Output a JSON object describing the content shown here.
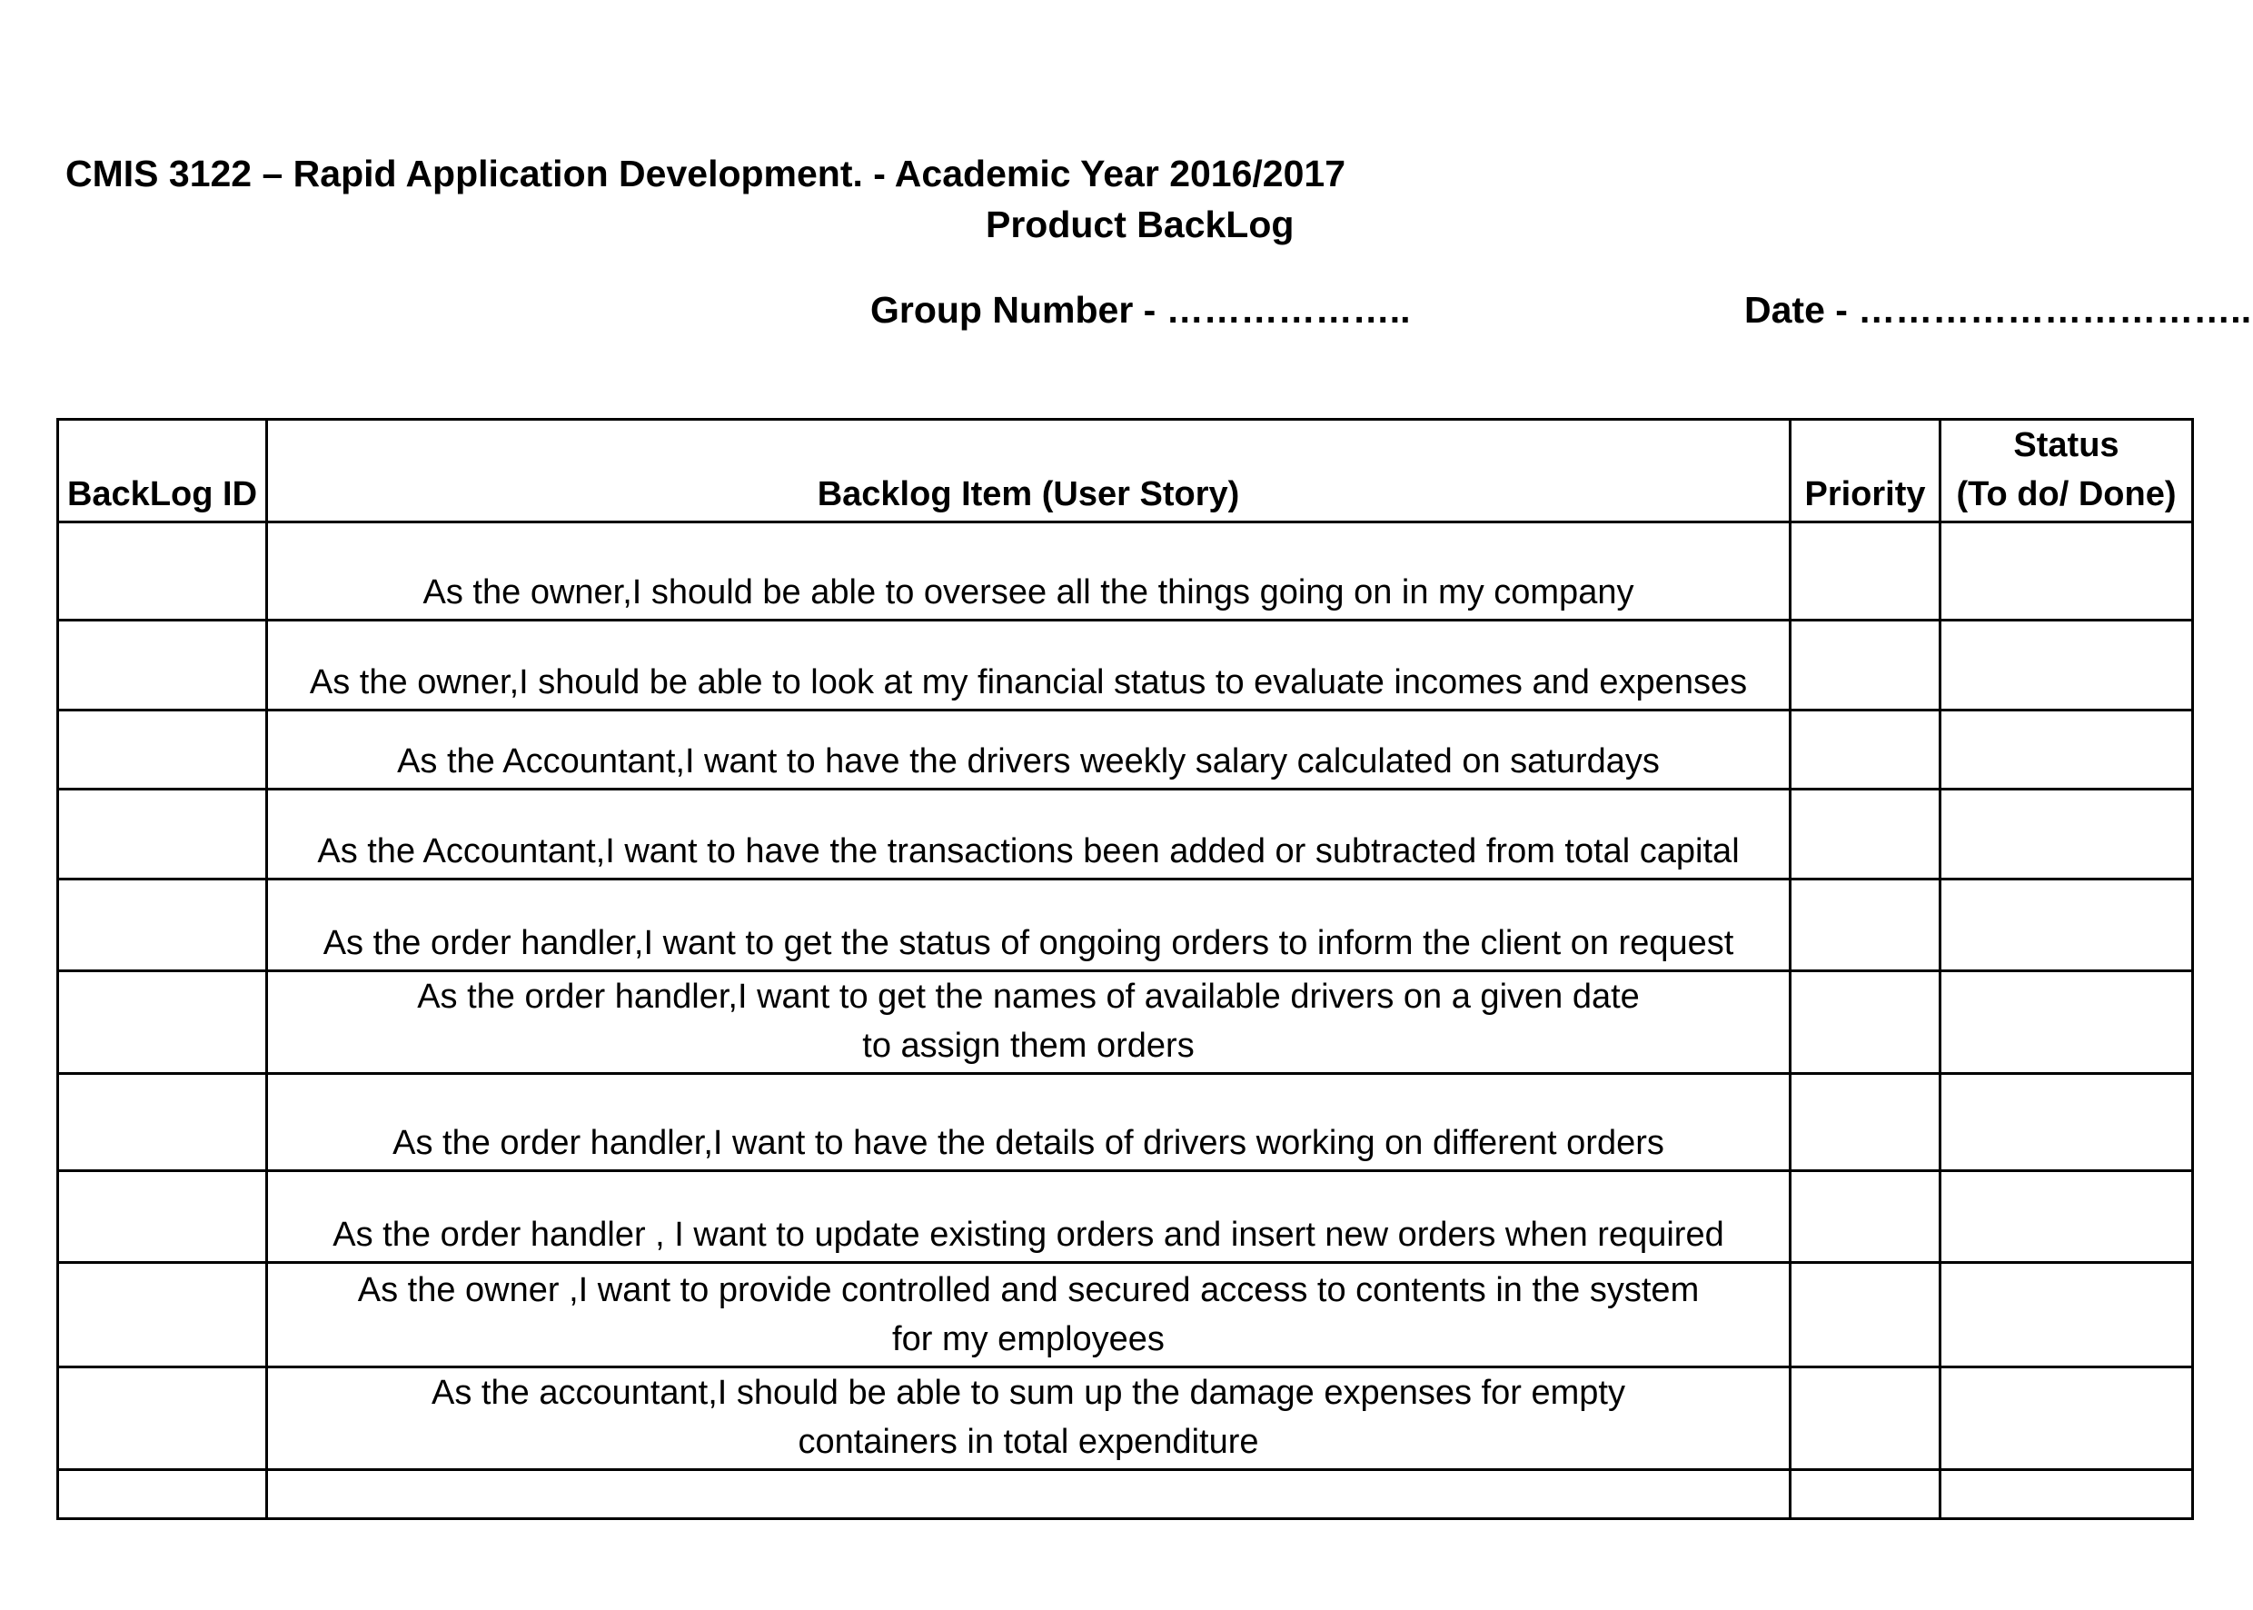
{
  "header": {
    "course": "CMIS 3122 – Rapid Application Development. - Academic Year 2016/2017",
    "title": "Product BackLog",
    "group_number": "Group Number - ………………..",
    "date": "Date - …………………………..."
  },
  "table": {
    "columns": {
      "id": "BackLog ID",
      "item": "Backlog Item (User Story)",
      "priority": "Priority",
      "status_line1": "Status",
      "status_line2": "(To do/ Done)"
    },
    "rows": [
      {
        "lines": [
          "As the owner,I should be able to oversee all the things going on in my company"
        ]
      },
      {
        "lines": [
          "As the owner,I should be able to  look at my financial status to evaluate incomes and expenses"
        ]
      },
      {
        "lines": [
          "As the Accountant,I want to have the drivers weekly salary calculated on saturdays"
        ]
      },
      {
        "lines": [
          "As the Accountant,I want to have the transactions been added or subtracted from total capital"
        ]
      },
      {
        "lines": [
          "As the order handler,I want to get the status of ongoing orders to inform the client on request"
        ]
      },
      {
        "lines": [
          "As the order handler,I want to get the names of available drivers on a given date",
          "to assign them orders"
        ]
      },
      {
        "lines": [
          "As the order handler,I  want to have the details of drivers working on different orders"
        ]
      },
      {
        "lines": [
          "As the order handler , I want to update existing orders and insert new orders when required"
        ]
      },
      {
        "lines": [
          "As the owner ,I want to provide controlled and secured access to contents in the system",
          "for my employees"
        ]
      },
      {
        "lines": [
          "As the accountant,I should be able to sum up the damage expenses for empty",
          "containers in total expenditure"
        ]
      },
      {
        "lines": []
      }
    ]
  }
}
